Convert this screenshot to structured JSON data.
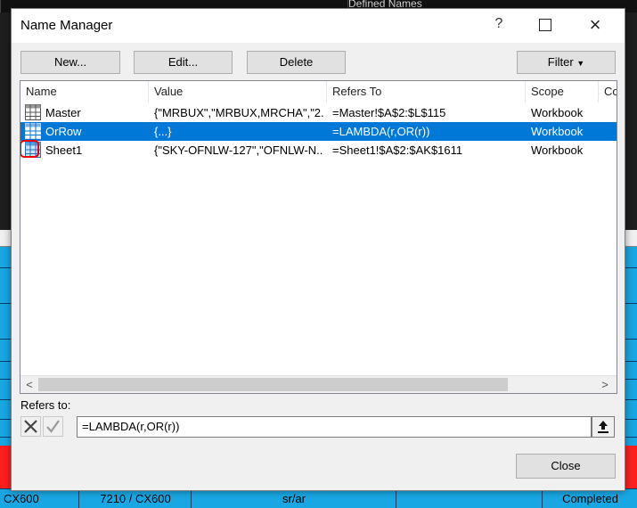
{
  "background": {
    "top_header_text": "Defined Names",
    "bottom_row": [
      "CX600",
      "7210 / CX600",
      "sr/ar",
      "Completed"
    ],
    "colors": {
      "sheet_blue": "#19a7e3",
      "sheet_red": "#ff1f1f"
    }
  },
  "dialog": {
    "title": "Name Manager",
    "help_icon": "?",
    "buttons": {
      "new": "New...",
      "edit": "Edit...",
      "delete": "Delete",
      "filter": "Filter",
      "close": "Close"
    },
    "columns": [
      "Name",
      "Value",
      "Refers To",
      "Scope",
      "Co"
    ],
    "rows": [
      {
        "name": "Master",
        "value": "{\"MRBUX\",\"MRBUX,MRCHA\",\"2...",
        "refers_to": "=Master!$A$2:$L$115",
        "scope": "Workbook",
        "icon": "table-icon"
      },
      {
        "name": "OrRow",
        "value": "{...}",
        "refers_to": "=LAMBDA(r,OR(r))",
        "scope": "Workbook",
        "icon": "table-icon"
      },
      {
        "name": "Sheet1",
        "value": "{\"SKY-OFNLW-127\",\"OFNLW-N...",
        "refers_to": "=Sheet1!$A$2:$AK$1611",
        "scope": "Workbook",
        "icon": "table-icon"
      }
    ],
    "selected_row": 1,
    "refers_to_label": "Refers to:",
    "refers_to_value": "=LAMBDA(r,OR(r))",
    "colors": {
      "selection": "#0078d7",
      "annotation": "#ee0000"
    }
  }
}
